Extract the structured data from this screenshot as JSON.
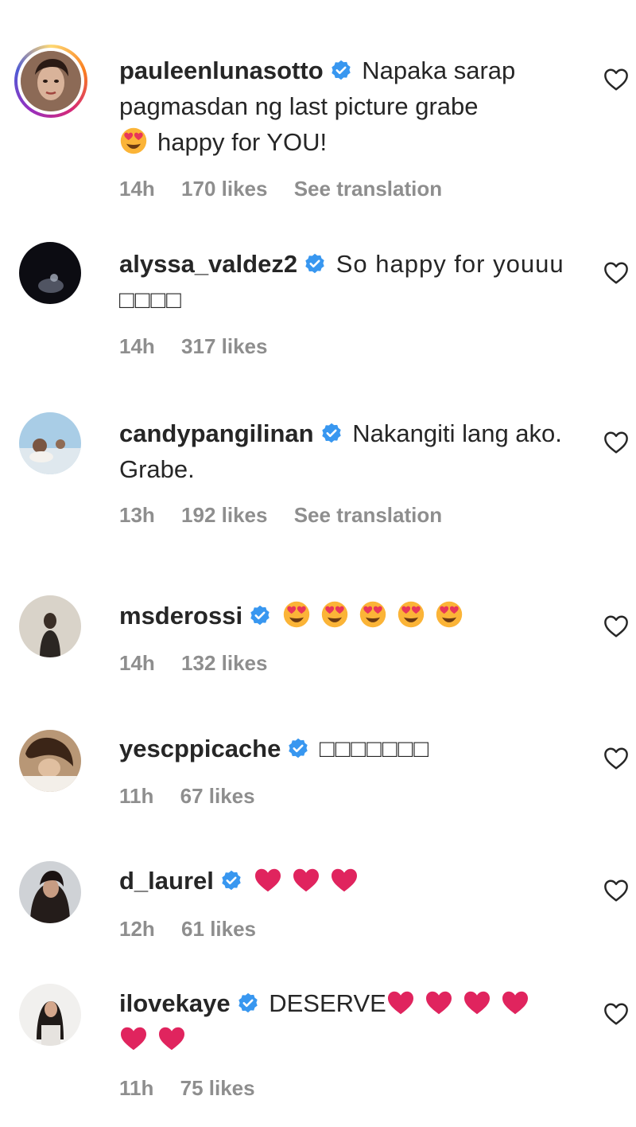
{
  "comments": [
    {
      "username": "pauleenlunasotto",
      "text_pre": "Napaka sarap pagmasdan ng last picture grabe",
      "text_post": "happy for YOU!",
      "time": "14h",
      "likes": "170 likes",
      "translation": "See translation"
    },
    {
      "username": "alyssa_valdez2",
      "text": "So happy for youuu □□□□",
      "time": "14h",
      "likes": "317 likes"
    },
    {
      "username": "candypangilinan",
      "text": "Nakangiti lang ako. Grabe.",
      "time": "13h",
      "likes": "192 likes",
      "translation": "See translation"
    },
    {
      "username": "msderossi",
      "time": "14h",
      "likes": "132 likes"
    },
    {
      "username": "yescppicache",
      "text": "□□□□□□□",
      "time": "11h",
      "likes": "67 likes"
    },
    {
      "username": "d_laurel",
      "time": "12h",
      "likes": "61 likes"
    },
    {
      "username": "ilovekaye",
      "text": "DESERVE",
      "time": "11h",
      "likes": "75 likes"
    }
  ],
  "icons": {
    "verified": "verified-badge-icon",
    "like": "heart-outline-icon",
    "heart_eyes": "heart-eyes-emoji",
    "red_heart": "red-heart-emoji"
  },
  "colors": {
    "verified_blue": "#3897f0",
    "meta_gray": "#8e8e8e",
    "heart_red": "#e0245e"
  }
}
